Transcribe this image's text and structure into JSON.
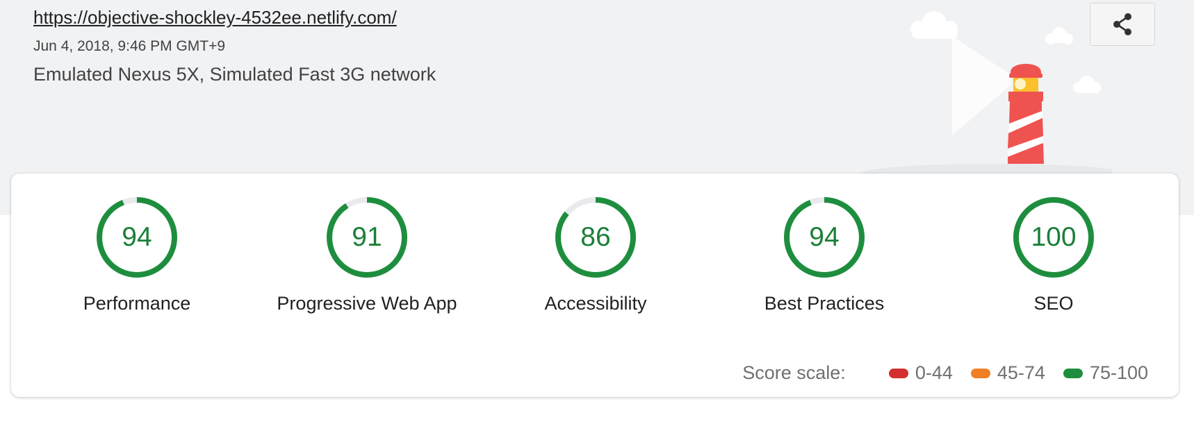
{
  "header": {
    "url": "https://objective-shockley-4532ee.netlify.com/",
    "date": "Jun 4, 2018, 9:46 PM GMT+9",
    "environment": "Emulated Nexus 5X, Simulated Fast 3G network"
  },
  "share": {
    "icon": "share-icon"
  },
  "categories": [
    {
      "score": "94",
      "fraction": 0.94,
      "label": "Performance"
    },
    {
      "score": "91",
      "fraction": 0.91,
      "label": "Progressive Web App"
    },
    {
      "score": "86",
      "fraction": 0.86,
      "label": "Accessibility"
    },
    {
      "score": "94",
      "fraction": 0.94,
      "label": "Best Practices"
    },
    {
      "score": "100",
      "fraction": 1.0,
      "label": "SEO"
    }
  ],
  "score_scale": {
    "title": "Score scale:",
    "ranges": [
      {
        "label": "0-44",
        "color": "#d32f2f"
      },
      {
        "label": "45-74",
        "color": "#ef7e27"
      },
      {
        "label": "75-100",
        "color": "#1e8e3e"
      }
    ]
  },
  "colors": {
    "pass": "#1e8e3e",
    "pass_text": "#1a7f37",
    "track": "#e8eaed",
    "lighthouse_red": "#ef5350",
    "lighthouse_yellow": "#fbc02d"
  }
}
